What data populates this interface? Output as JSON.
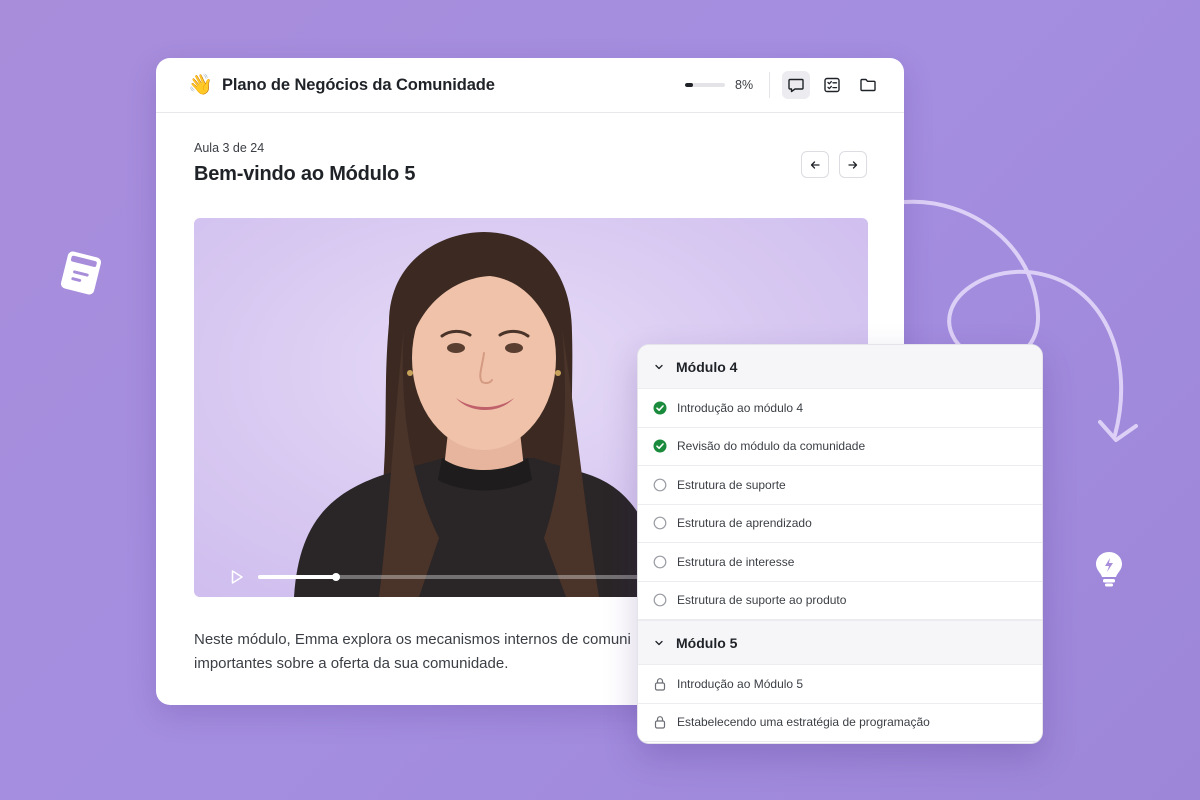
{
  "course": {
    "title": "Plano de Negócios da Comunidade",
    "emoji": "👋",
    "progress_percent": 8,
    "progress_label": "8%"
  },
  "header_icons": [
    "chat-icon",
    "checklist-icon",
    "folder-icon"
  ],
  "lesson": {
    "meta": "Aula 3 de 24",
    "title": "Bem-vindo ao Módulo 5",
    "description_line1": "Neste módulo, Emma explora os mecanismos internos de comuni",
    "description_line2": "importantes sobre a oferta da sua comunidade."
  },
  "video": {
    "progress_fraction": 0.13
  },
  "modules": [
    {
      "name": "Módulo 4",
      "lessons": [
        {
          "label": "Introdução ao módulo 4",
          "status": "done"
        },
        {
          "label": "Revisão do módulo da comunidade",
          "status": "done"
        },
        {
          "label": "Estrutura de suporte",
          "status": "todo"
        },
        {
          "label": "Estrutura de aprendizado",
          "status": "todo"
        },
        {
          "label": "Estrutura de interesse",
          "status": "todo"
        },
        {
          "label": "Estrutura de suporte ao produto",
          "status": "todo"
        }
      ]
    },
    {
      "name": "Módulo 5",
      "lessons": [
        {
          "label": "Introdução ao Módulo 5",
          "status": "locked"
        },
        {
          "label": "Estabelecendo uma estratégia de programação",
          "status": "locked"
        }
      ]
    }
  ],
  "colors": {
    "background": "#a88ddb",
    "done_green": "#1a8a3c",
    "text_primary": "#1f2328",
    "text_secondary": "#3b3f45"
  }
}
